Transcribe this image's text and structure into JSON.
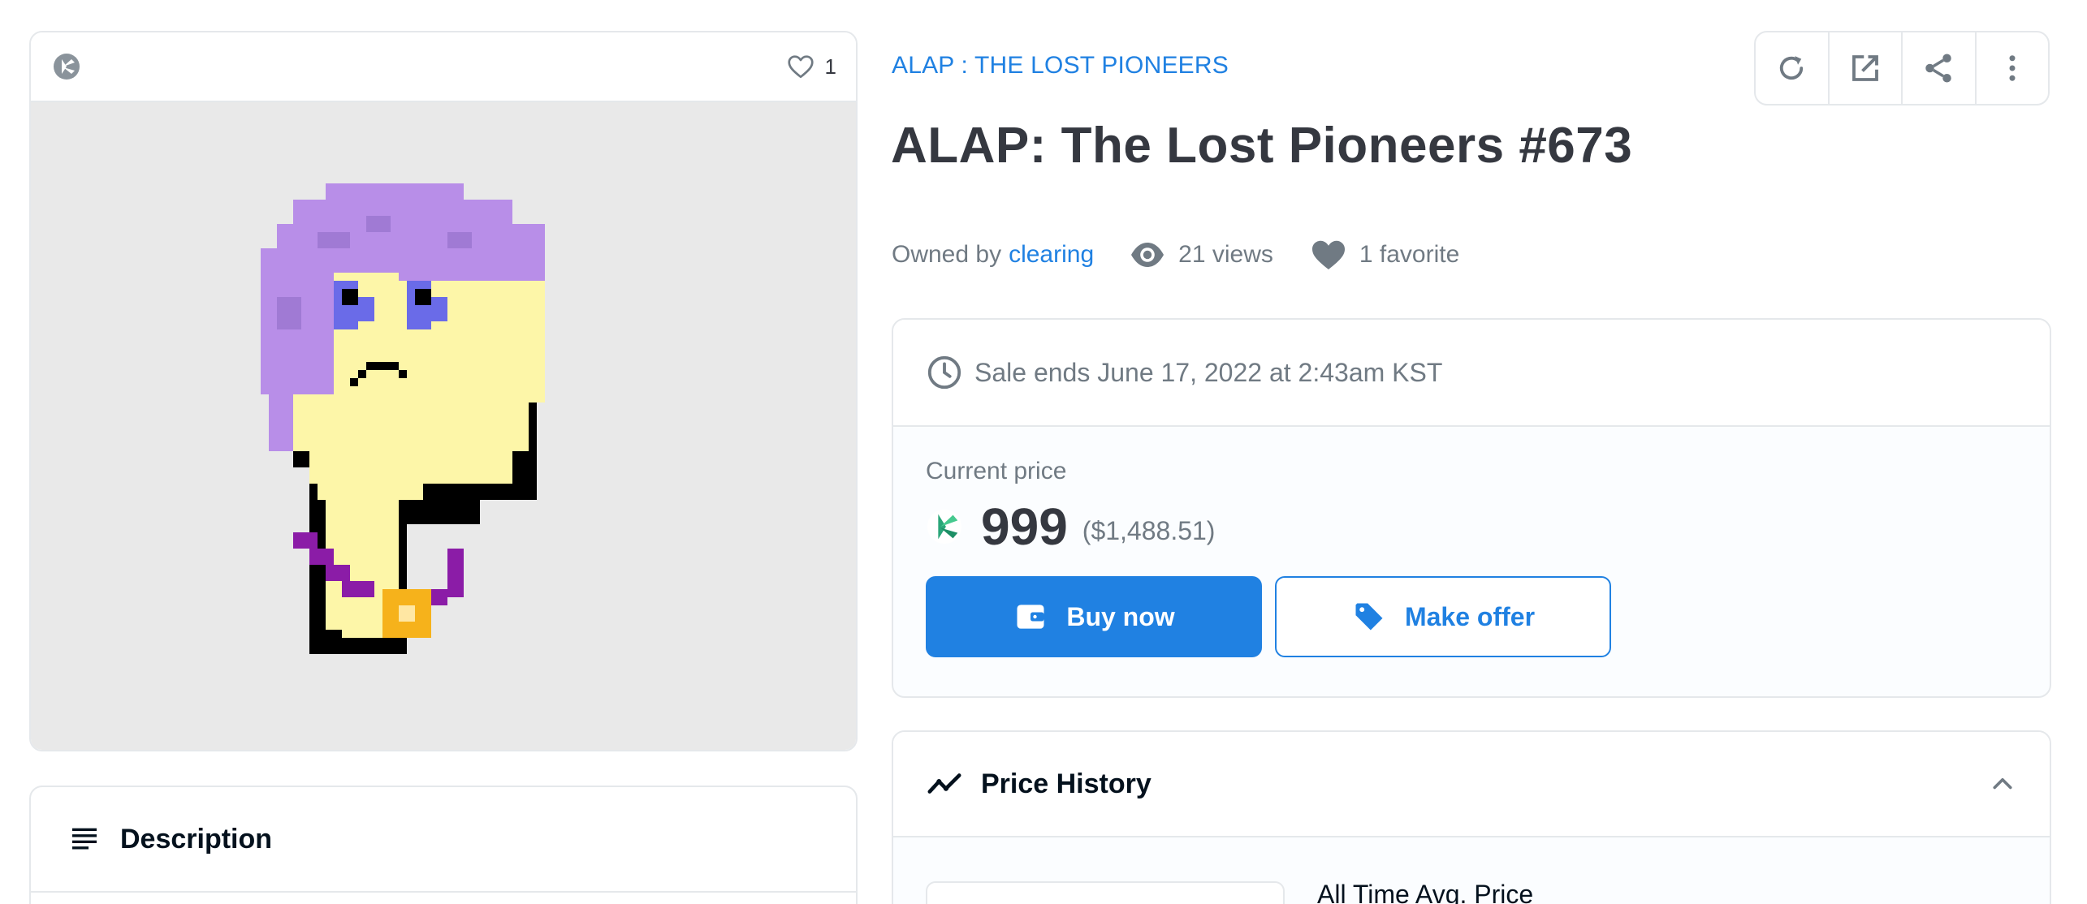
{
  "asset_card": {
    "chain_icon": "klaytn-icon",
    "favorite_count": "1"
  },
  "description": {
    "title": "Description"
  },
  "collection": {
    "name": "ALAP : THE LOST PIONEERS"
  },
  "toolbar": {
    "buttons": [
      "refresh-icon",
      "external-link-icon",
      "share-icon",
      "more-vertical-icon"
    ]
  },
  "asset": {
    "title": "ALAP: The Lost Pioneers #673"
  },
  "meta": {
    "owned_by_label": "Owned by",
    "owner": "clearing",
    "views": "21 views",
    "favorites": "1 favorite"
  },
  "sale": {
    "ends_text": "Sale ends June 17, 2022 at 2:43am KST"
  },
  "price": {
    "label": "Current price",
    "amount": "999",
    "usd": "($1,488.51)"
  },
  "actions": {
    "buy_label": "Buy now",
    "offer_label": "Make offer"
  },
  "price_history": {
    "title": "Price History",
    "avg_label": "All Time Avg. Price"
  },
  "colors": {
    "accent": "#2081e2",
    "text": "#353840",
    "muted": "#707a83",
    "border": "#e5e8eb"
  }
}
